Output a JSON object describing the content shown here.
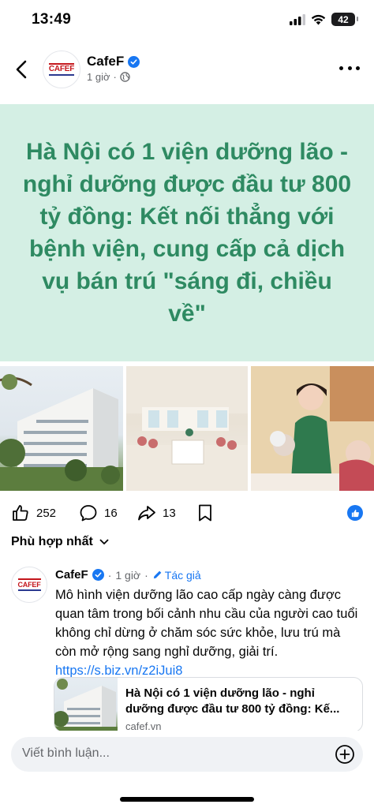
{
  "status_bar": {
    "time": "13:49",
    "battery": "42"
  },
  "header": {
    "page_name": "CafeF",
    "time": "1 giờ",
    "logo_text": "CAFEF"
  },
  "banner": {
    "title": "Hà Nội có 1 viện dưỡng lão - nghỉ dưỡng được đầu tư 800 tỷ đồng: Kết nối thẳng với bệnh viện, cung cấp cả dịch vụ bán trú \"sáng đi, chiều về\""
  },
  "reactions": {
    "likes": "252",
    "comments": "16",
    "shares": "13"
  },
  "sort": {
    "label": "Phù hợp nhất"
  },
  "comment": {
    "author": "CafeF",
    "time": "1 giờ",
    "author_badge": "Tác giả",
    "text": "Mô hình viện dưỡng lão cao cấp ngày càng được quan tâm trong bối cảnh nhu cầu của người cao tuổi không chỉ dừng ở chăm sóc sức khỏe, lưu trú mà còn mở rộng sang nghỉ dưỡng, giải trí.",
    "link": "https://s.biz.vn/z2iJui8"
  },
  "link_card": {
    "title": "Hà Nội có 1 viện dưỡng lão - nghỉ dưỡng được đầu tư 800 tỷ đồng: Kế...",
    "domain": "cafef.vn"
  },
  "composer": {
    "placeholder": "Viết bình luận..."
  },
  "colors": {
    "banner_bg": "#d4efe4",
    "banner_text": "#2e8a62",
    "facebook_blue": "#1877f2",
    "logo_red": "#c4161c"
  }
}
